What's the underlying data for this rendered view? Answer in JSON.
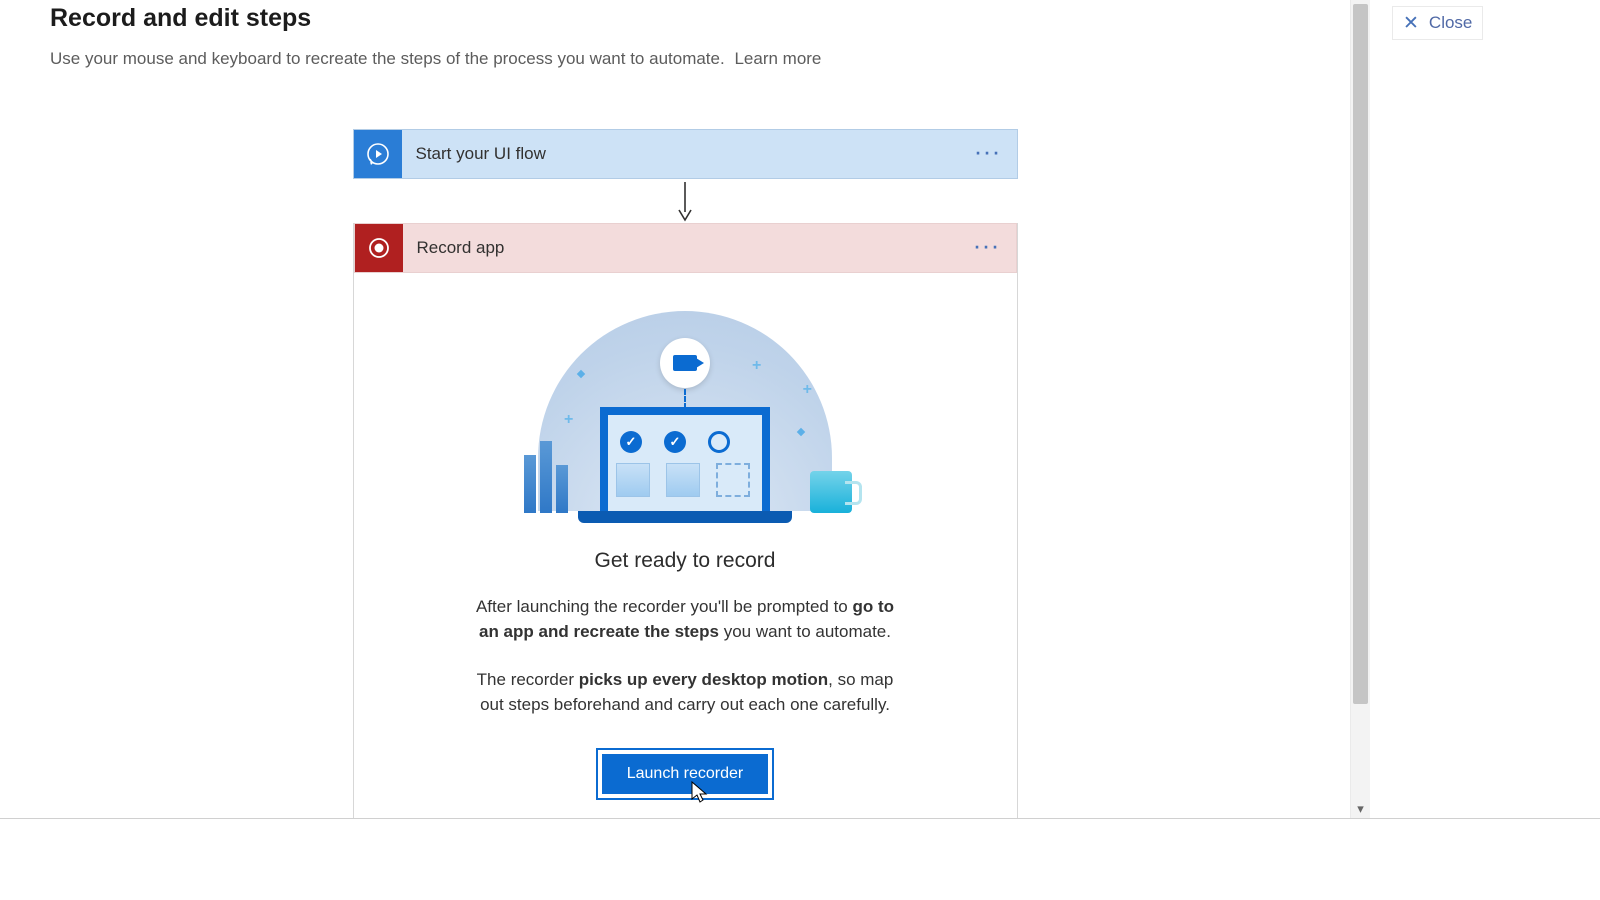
{
  "page": {
    "title": "Record and edit steps",
    "subtitle": "Use your mouse and keyboard to recreate the steps of the process you want to automate.",
    "learn_more": "Learn more"
  },
  "steps": {
    "start": {
      "label": "Start your UI flow",
      "more": "···"
    },
    "record": {
      "label": "Record app",
      "more": "···",
      "body_title": "Get ready to record",
      "para1_prefix": "After launching the recorder you'll be prompted to ",
      "para1_bold": "go to an app and recreate the steps",
      "para1_suffix": " you want to automate.",
      "para2_prefix": "The recorder ",
      "para2_bold": "picks up every desktop motion",
      "para2_suffix": ", so map out steps beforehand and carry out each one carefully.",
      "launch_label": "Launch recorder"
    }
  },
  "close_label": "Close"
}
